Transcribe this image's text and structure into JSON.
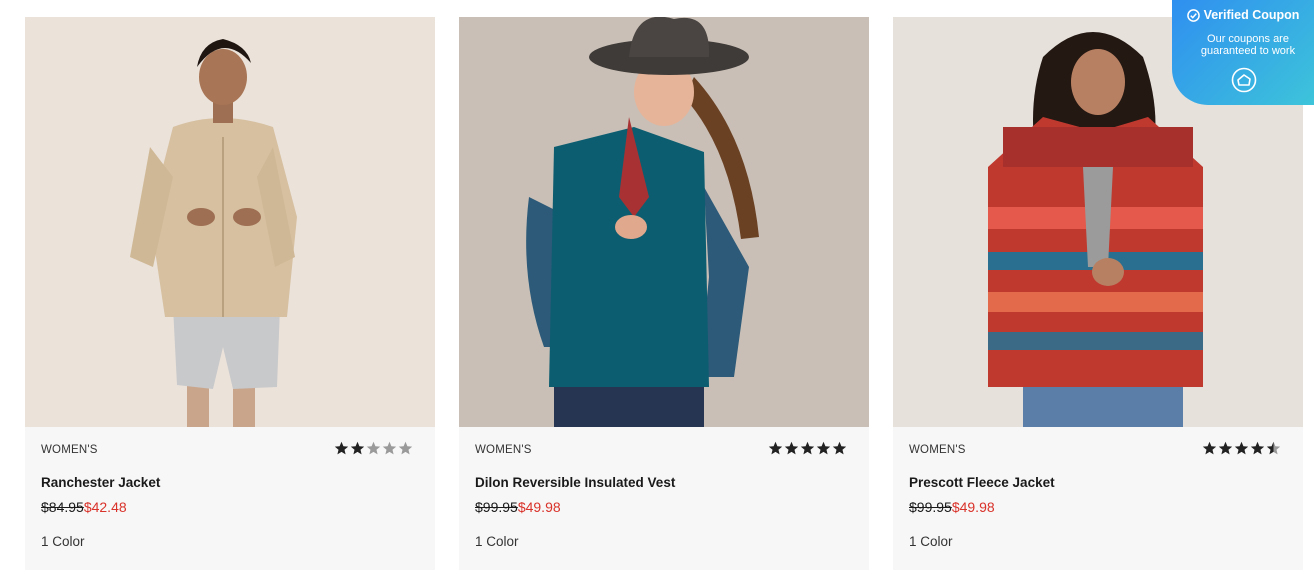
{
  "products": [
    {
      "category": "WOMEN'S",
      "name": "Ranchester Jacket",
      "original_price": "$84.95",
      "sale_price": "$42.48",
      "colors": "1 Color",
      "rating": 2,
      "rating_max": 5,
      "image": "woman-in-tan-shirt-jacket-and-denim-shorts"
    },
    {
      "category": "WOMEN'S",
      "name": "Dilon Reversible Insulated Vest",
      "original_price": "$99.95",
      "sale_price": "$49.98",
      "colors": "1 Color",
      "rating": 5,
      "rating_max": 5,
      "image": "woman-in-cowboy-hat-and-teal-quilted-vest"
    },
    {
      "category": "WOMEN'S",
      "name": "Prescott Fleece Jacket",
      "original_price": "$99.95",
      "sale_price": "$49.98",
      "colors": "1 Color",
      "rating": 4.5,
      "rating_max": 5,
      "image": "woman-in-red-aztec-pattern-fleece-jacket"
    }
  ],
  "coupon_badge": {
    "title": "Verified Coupon",
    "subtitle": "Our coupons are guaranteed to work",
    "icons": [
      "check-circle-icon",
      "house-logo-icon"
    ]
  },
  "colors": {
    "sale_red": "#d9322a",
    "card_bg": "#f7f7f7",
    "star_filled": "#222222",
    "star_empty": "#9a9a9a",
    "badge_gradient_start": "#2f8ff0",
    "badge_gradient_end": "#3dc4da"
  }
}
